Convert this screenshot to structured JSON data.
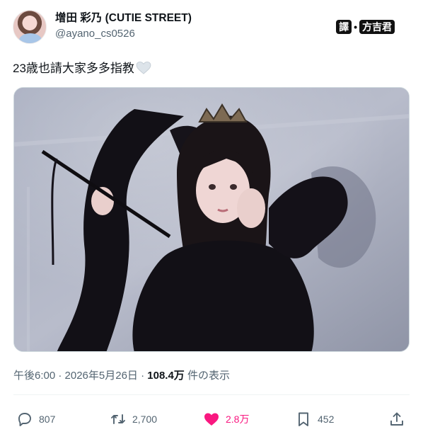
{
  "post": {
    "display_name": "增田 彩乃 (CUTIE STREET)",
    "handle": "@ayano_cs0526",
    "text": "23歳也請大家多多指教",
    "timestamp": "午後6:00 · 2026年5月26日 · ",
    "views_count": "108.4万",
    "views_label": " 件の表示"
  },
  "watermark": {
    "left": "譯",
    "sep": "•",
    "right": "方吉君"
  },
  "actions": {
    "replies": "807",
    "reposts": "2,700",
    "likes": "2.8万",
    "bookmarks": "452"
  },
  "colors": {
    "like_active": "#f91880",
    "secondary_text": "#536471",
    "primary_text": "#0f1419"
  },
  "icons": [
    "reply-icon",
    "repost-icon",
    "heart-icon",
    "bookmark-icon",
    "share-icon",
    "white-heart-emoji"
  ]
}
